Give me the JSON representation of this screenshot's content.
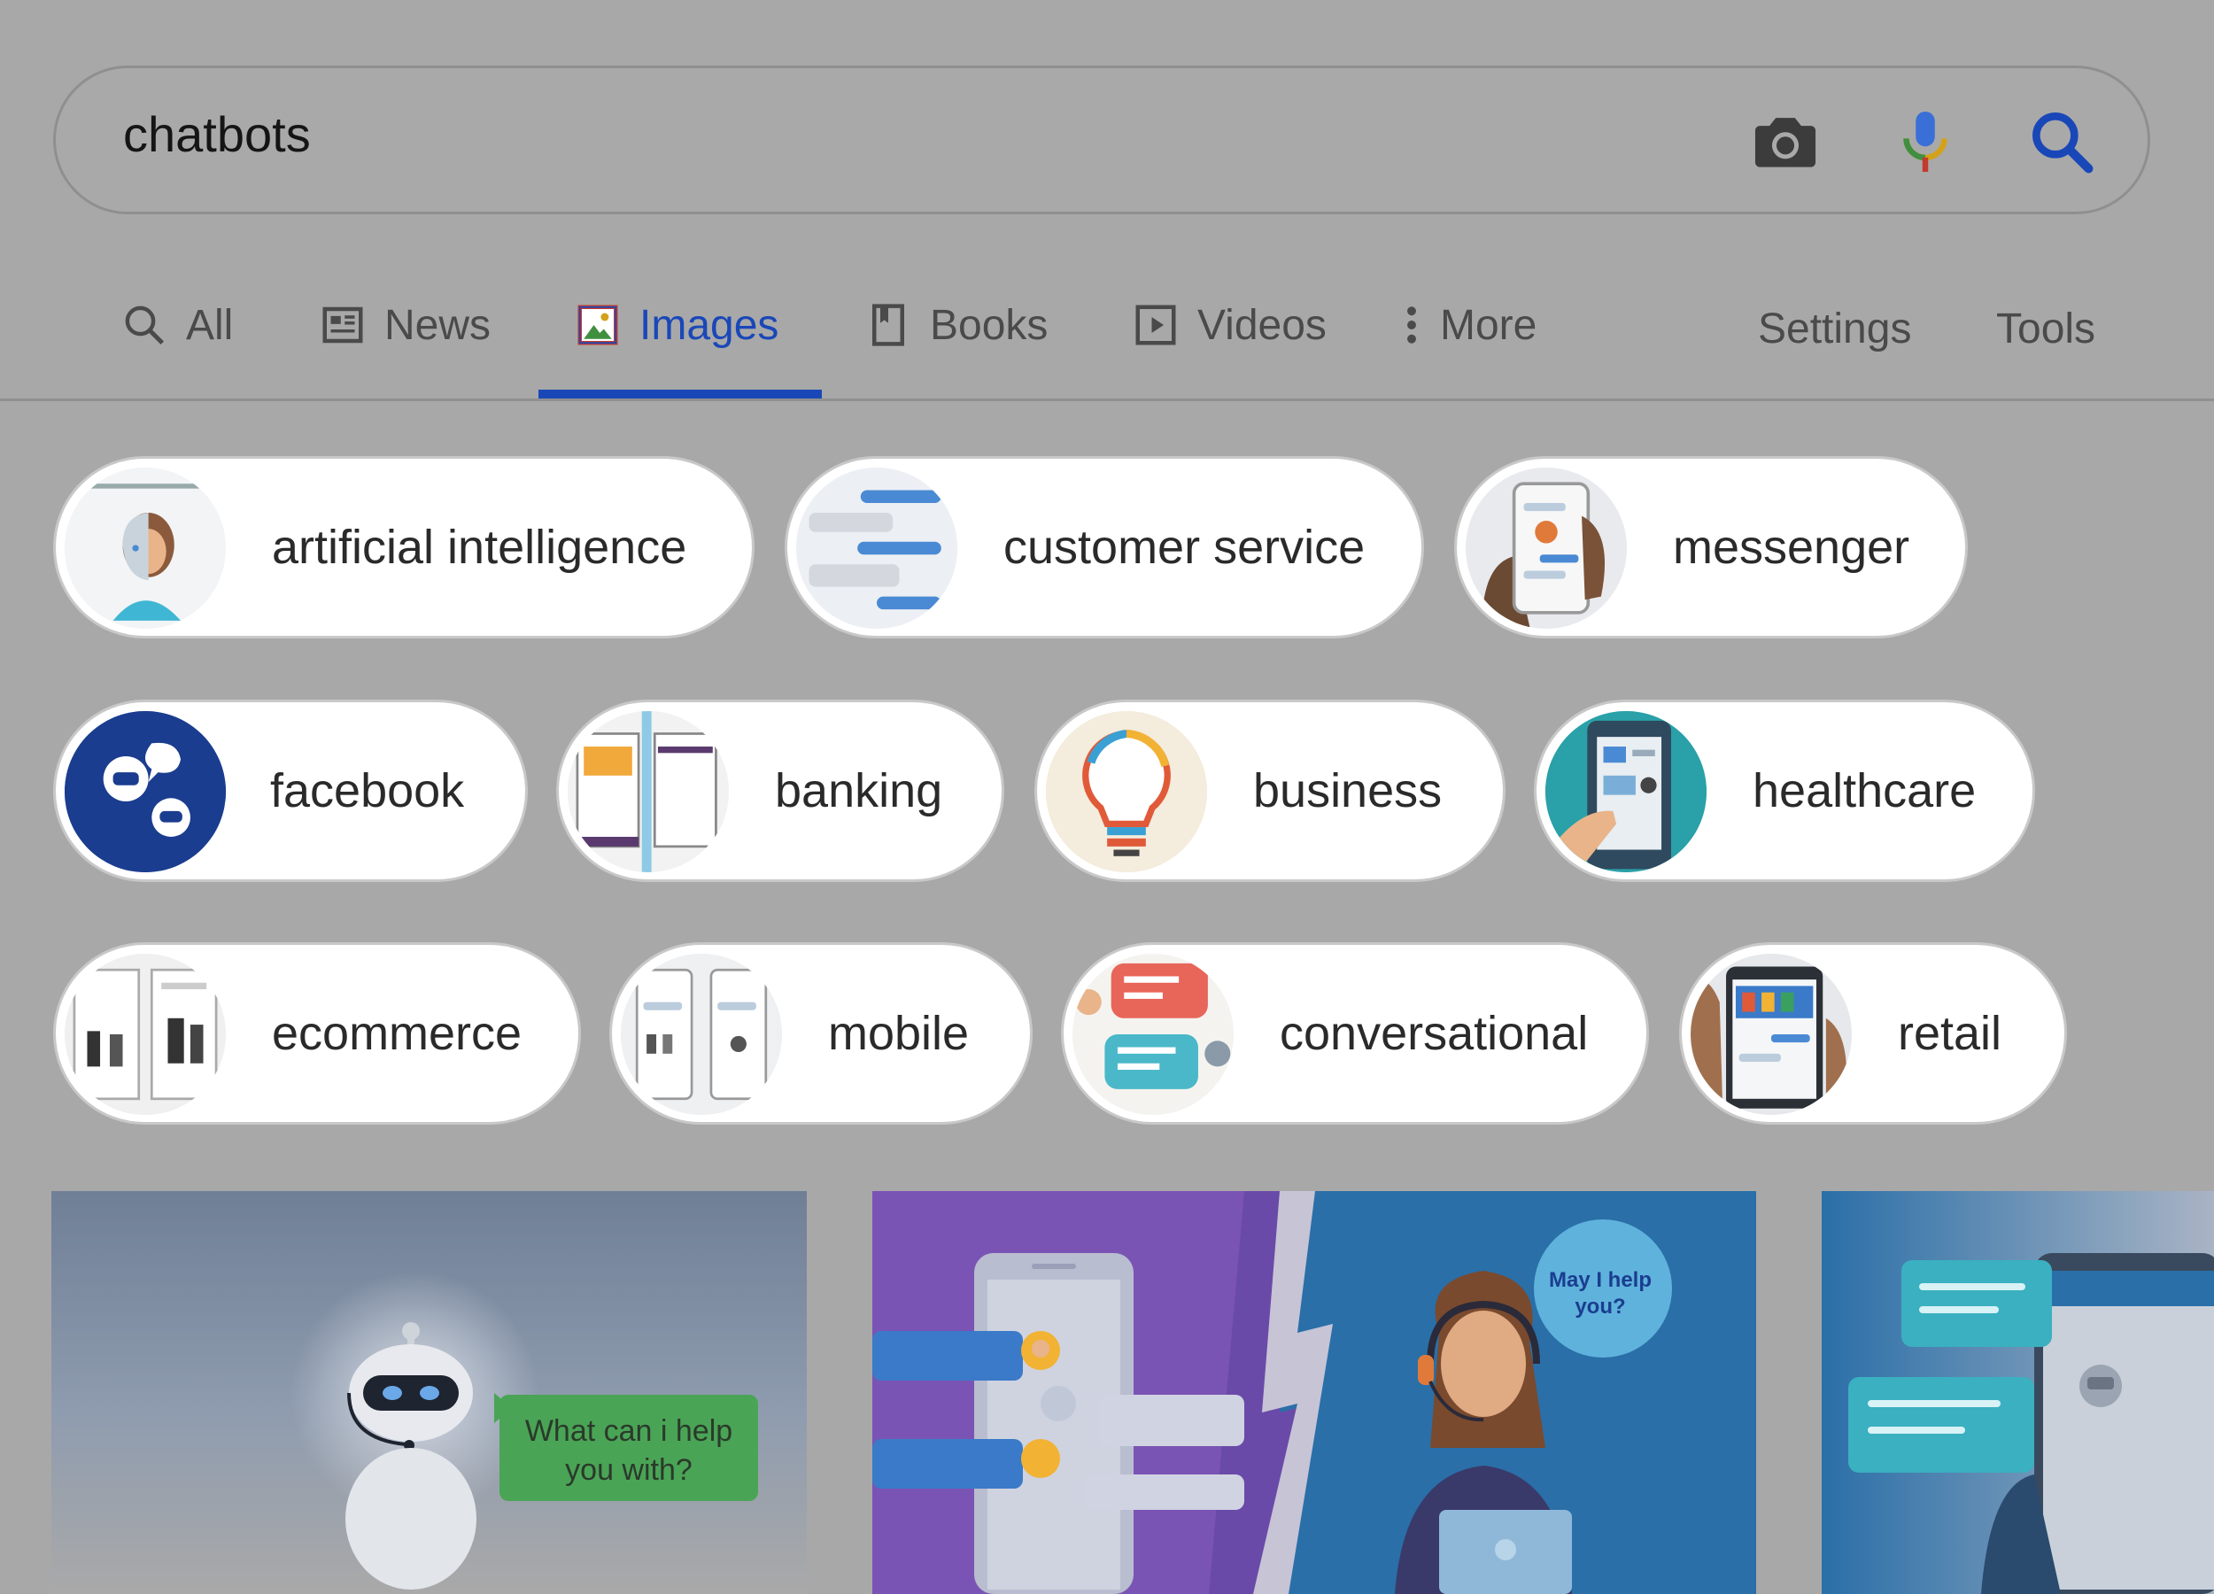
{
  "search": {
    "query": "chatbots"
  },
  "icons": {
    "camera": "camera-icon",
    "mic": "microphone-icon",
    "search": "search-icon"
  },
  "tabs": [
    {
      "label": "All",
      "icon": "search-icon"
    },
    {
      "label": "News",
      "icon": "news-icon"
    },
    {
      "label": "Images",
      "icon": "images-icon",
      "active": true
    },
    {
      "label": "Books",
      "icon": "books-icon"
    },
    {
      "label": "Videos",
      "icon": "videos-icon"
    },
    {
      "label": "More",
      "icon": "more-vertical-icon"
    }
  ],
  "right_links": {
    "settings": "Settings",
    "tools": "Tools"
  },
  "chips": [
    {
      "label": "artificial intelligence"
    },
    {
      "label": "customer service"
    },
    {
      "label": "messenger"
    },
    {
      "label": "facebook"
    },
    {
      "label": "banking"
    },
    {
      "label": "business"
    },
    {
      "label": "healthcare"
    },
    {
      "label": "ecommerce"
    },
    {
      "label": "mobile"
    },
    {
      "label": "conversational"
    },
    {
      "label": "retail"
    }
  ],
  "results": [
    {
      "caption": "What can i help you with?"
    },
    {
      "caption": "May I help you?"
    },
    {
      "caption": ""
    }
  ],
  "colors": {
    "accent": "#1a47b8",
    "background": "#a8a8a8",
    "chip_bg": "#ffffff"
  }
}
